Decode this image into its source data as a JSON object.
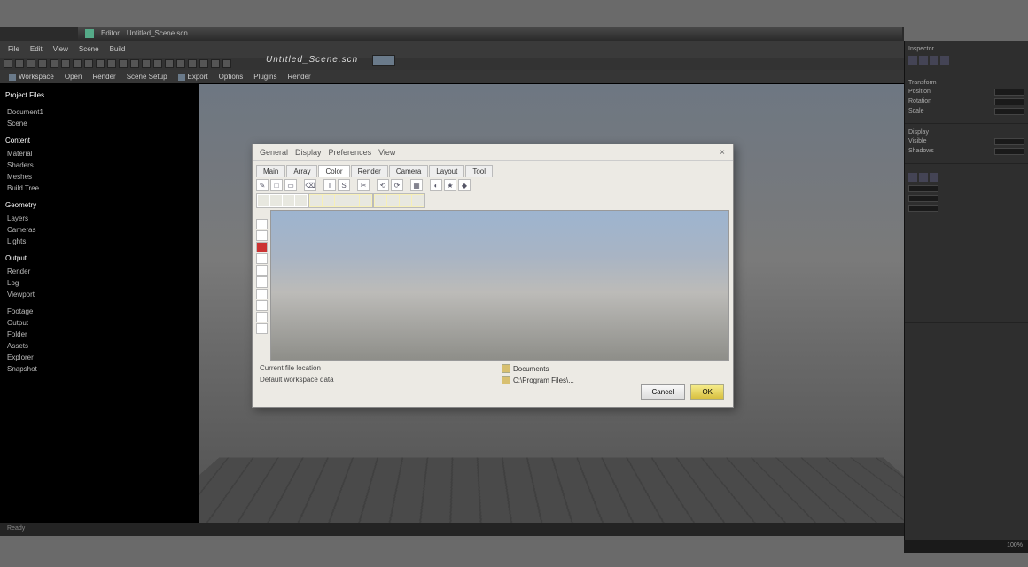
{
  "title": {
    "app": "Editor",
    "document": "Untitled_Scene.scn"
  },
  "menu": [
    "File",
    "Edit",
    "View",
    "Scene",
    "Build"
  ],
  "doctitle": "Untitled_Scene.scn",
  "ribbon": [
    "Workspace",
    "Open",
    "Render",
    "Scene Setup",
    "Export",
    "Options",
    "Plugins",
    "Render"
  ],
  "left": {
    "header": "Project Files",
    "sections": [
      {
        "title": "",
        "items": [
          "Document1",
          "Scene"
        ]
      },
      {
        "title": "Content",
        "items": [
          "Material",
          "Shaders",
          "Meshes",
          "Build Tree"
        ]
      },
      {
        "title": "Geometry",
        "items": [
          "Layers",
          "Cameras",
          "Lights"
        ]
      },
      {
        "title": "Output",
        "items": [
          "Render",
          "Log",
          "Viewport"
        ]
      },
      {
        "title": "",
        "items": [
          "Footage",
          "Output",
          "Folder",
          "Assets",
          "Explorer",
          "Snapshot"
        ]
      }
    ]
  },
  "dialog": {
    "tabs1": [
      "General",
      "Display",
      "Preferences",
      "View"
    ],
    "tabs2": [
      "Main",
      "Array",
      "Color",
      "Render",
      "Camera",
      "Layout",
      "Tool"
    ],
    "footer": {
      "l1": "Current file location",
      "l2": "Default workspace data",
      "r1": "Documents",
      "r2": "C:\\Program Files\\..."
    },
    "btn_cancel": "Cancel",
    "btn_ok": "OK"
  },
  "right": {
    "g1": "Inspector",
    "g2": "Transform",
    "g3": "Display",
    "items": [
      "Position",
      "Rotation",
      "Scale",
      "Visible",
      "Shadows"
    ]
  },
  "status": "Ready",
  "rstatus": "100%"
}
